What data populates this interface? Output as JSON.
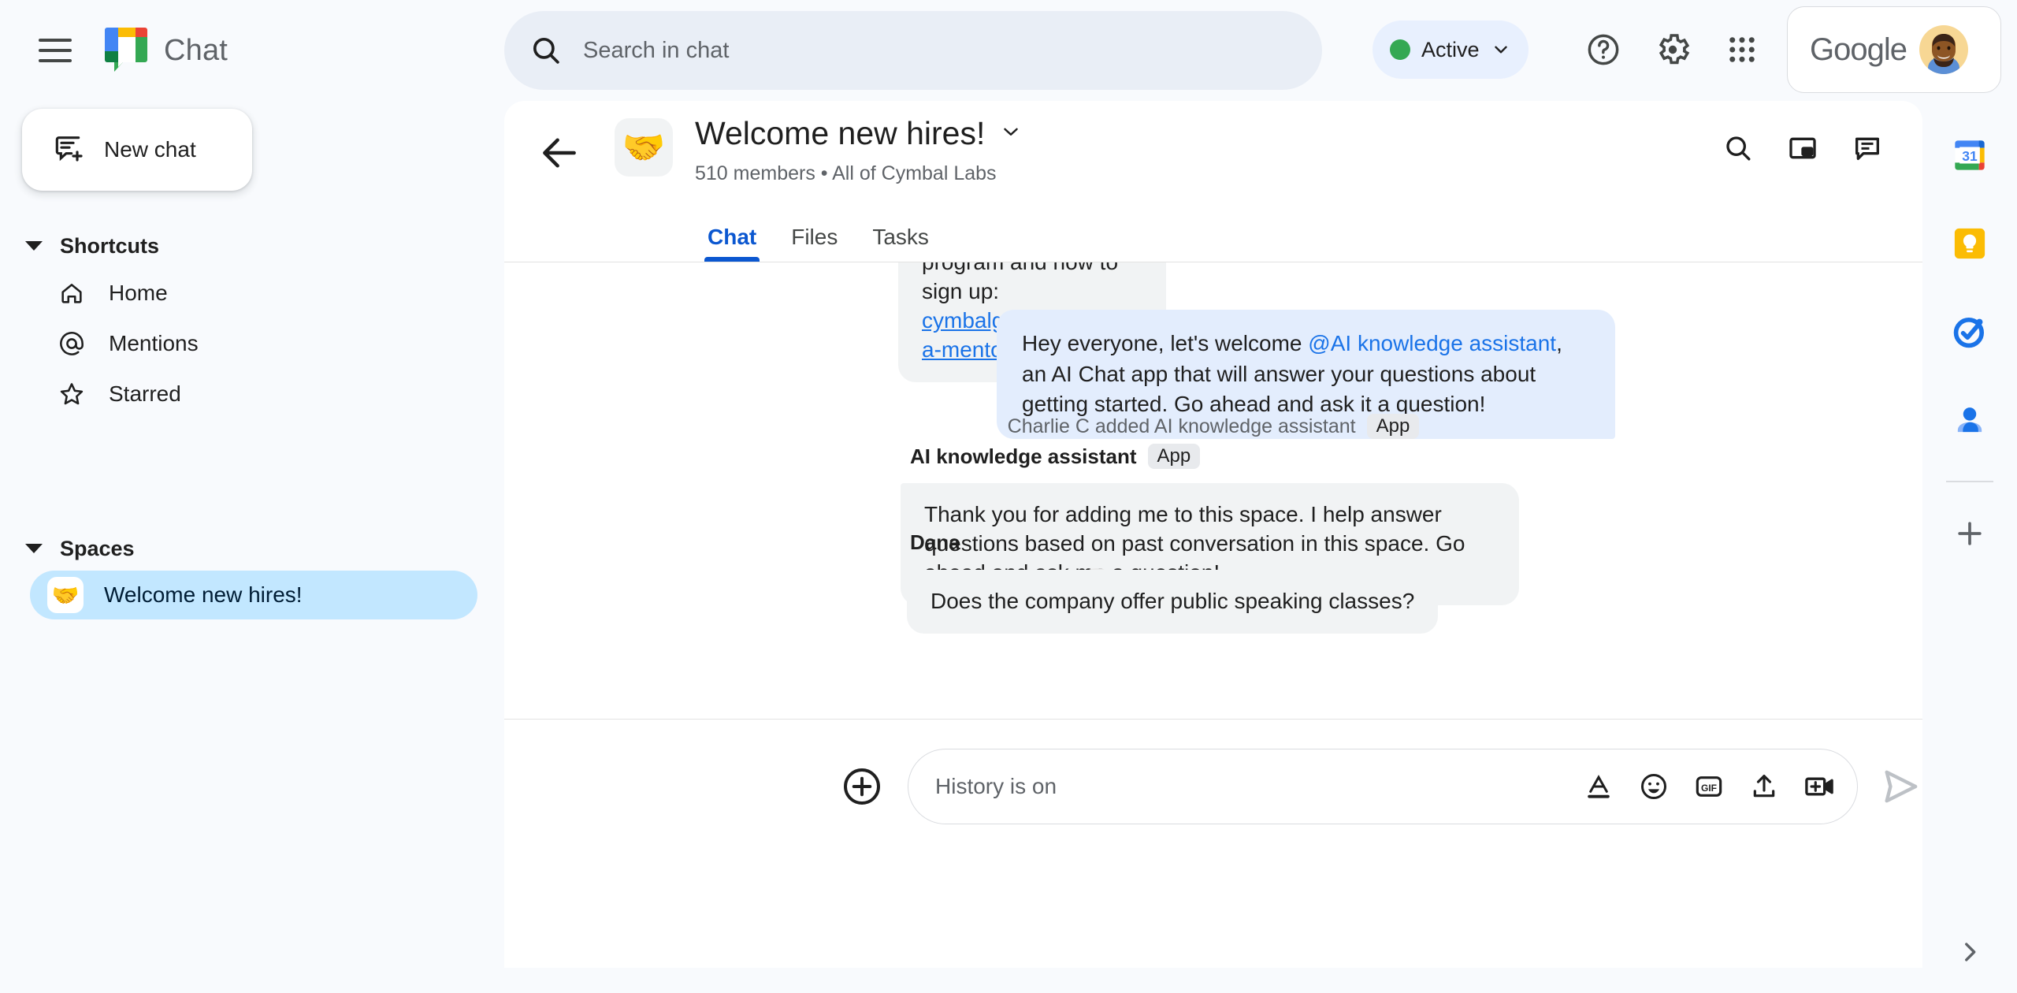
{
  "topbar": {
    "menu_icon": "hamburger-menu-icon",
    "brand": "Chat",
    "brand_logo_icon": "google-chat-logo",
    "search": {
      "icon": "search-icon",
      "placeholder": "Search in chat",
      "value": ""
    },
    "presence": {
      "label": "Active",
      "dot_color": "#34a853",
      "chevron_icon": "chevron-down-icon"
    },
    "help_icon": "help-circle-icon",
    "settings_icon": "gear-icon",
    "apps_icon": "apps-grid-icon",
    "account": {
      "word": "Google",
      "avatar_icon": "user-avatar"
    }
  },
  "sidebar": {
    "new_chat": {
      "label": "New chat",
      "icon": "new-chat-icon"
    },
    "sections": [
      {
        "title": "Shortcuts",
        "caret_icon": "caret-down-icon",
        "items": [
          {
            "label": "Home",
            "icon": "home-icon"
          },
          {
            "label": "Mentions",
            "icon": "at-sign-icon"
          },
          {
            "label": "Starred",
            "icon": "star-icon"
          }
        ]
      },
      {
        "title": "Spaces",
        "caret_icon": "caret-down-icon",
        "items": [
          {
            "label": "Welcome new hires!",
            "emoji": "🤝",
            "selected": true
          }
        ]
      }
    ]
  },
  "space": {
    "back_icon": "back-arrow-icon",
    "emoji": "🤝",
    "title": "Welcome new hires!",
    "title_chevron_icon": "chevron-down-icon",
    "subtitle": "510 members  •  All of Cymbal Labs",
    "actions": [
      {
        "icon": "search-icon",
        "name": "search-in-space-button"
      },
      {
        "icon": "picture-in-picture-icon",
        "name": "open-in-pip-button"
      },
      {
        "icon": "chat-bubble-icon",
        "name": "conversation-toggle-button"
      }
    ],
    "tabs": [
      {
        "label": "Chat",
        "active": true
      },
      {
        "label": "Files",
        "active": false
      },
      {
        "label": "Tasks",
        "active": false
      }
    ]
  },
  "messages": {
    "partial_top": {
      "line1": "program and how to sign up:",
      "link": "cymbalgroup.com/find-a-mentor"
    },
    "outgoing": {
      "prefix": "Hey everyone, let's welcome ",
      "mention": "@AI knowledge assistant",
      "suffix": ", an AI Chat app that will answer your questions about getting started.  Go ahead and ask it a question!"
    },
    "system_event": {
      "text": "Charlie C added AI knowledge assistant",
      "chip": "App"
    },
    "assistant": {
      "author": "AI knowledge assistant",
      "chip": "App",
      "avatar_icon": "question-mark-app-icon",
      "text": "Thank you for adding me to this space. I help answer questions based on past conversation in this space. Go ahead and ask me a question!"
    },
    "user": {
      "author": "Dana",
      "avatar_icon": "dana-avatar",
      "text": "Does the company offer public speaking classes?"
    }
  },
  "composer": {
    "plus_icon": "add-circle-icon",
    "placeholder": "History is on",
    "value": "",
    "tools": [
      {
        "icon": "format-text-icon",
        "name": "format-button"
      },
      {
        "icon": "emoji-smiley-icon",
        "name": "emoji-button"
      },
      {
        "icon": "gif-icon",
        "name": "gif-button"
      },
      {
        "icon": "upload-icon",
        "name": "upload-file-button"
      },
      {
        "icon": "add-video-icon",
        "name": "add-meeting-button"
      }
    ],
    "send_icon": "send-arrow-icon"
  },
  "rightrail": {
    "items": [
      {
        "name": "google-calendar-icon",
        "label": "31"
      },
      {
        "name": "google-keep-icon"
      },
      {
        "name": "google-tasks-icon"
      },
      {
        "name": "google-contacts-icon"
      }
    ],
    "add_icon": "plus-icon",
    "expand_icon": "chevron-right-icon"
  },
  "colors": {
    "page_bg": "#f8fafd",
    "panel_bg": "#ffffff",
    "accent_blue": "#0b57d0",
    "link_blue": "#1a73e8",
    "bubble_gray": "#f1f3f4",
    "bubble_blue": "#e3edfd",
    "space_selected": "#c2e7ff",
    "search_bg": "#e9eef6",
    "presence_green": "#34a853"
  }
}
